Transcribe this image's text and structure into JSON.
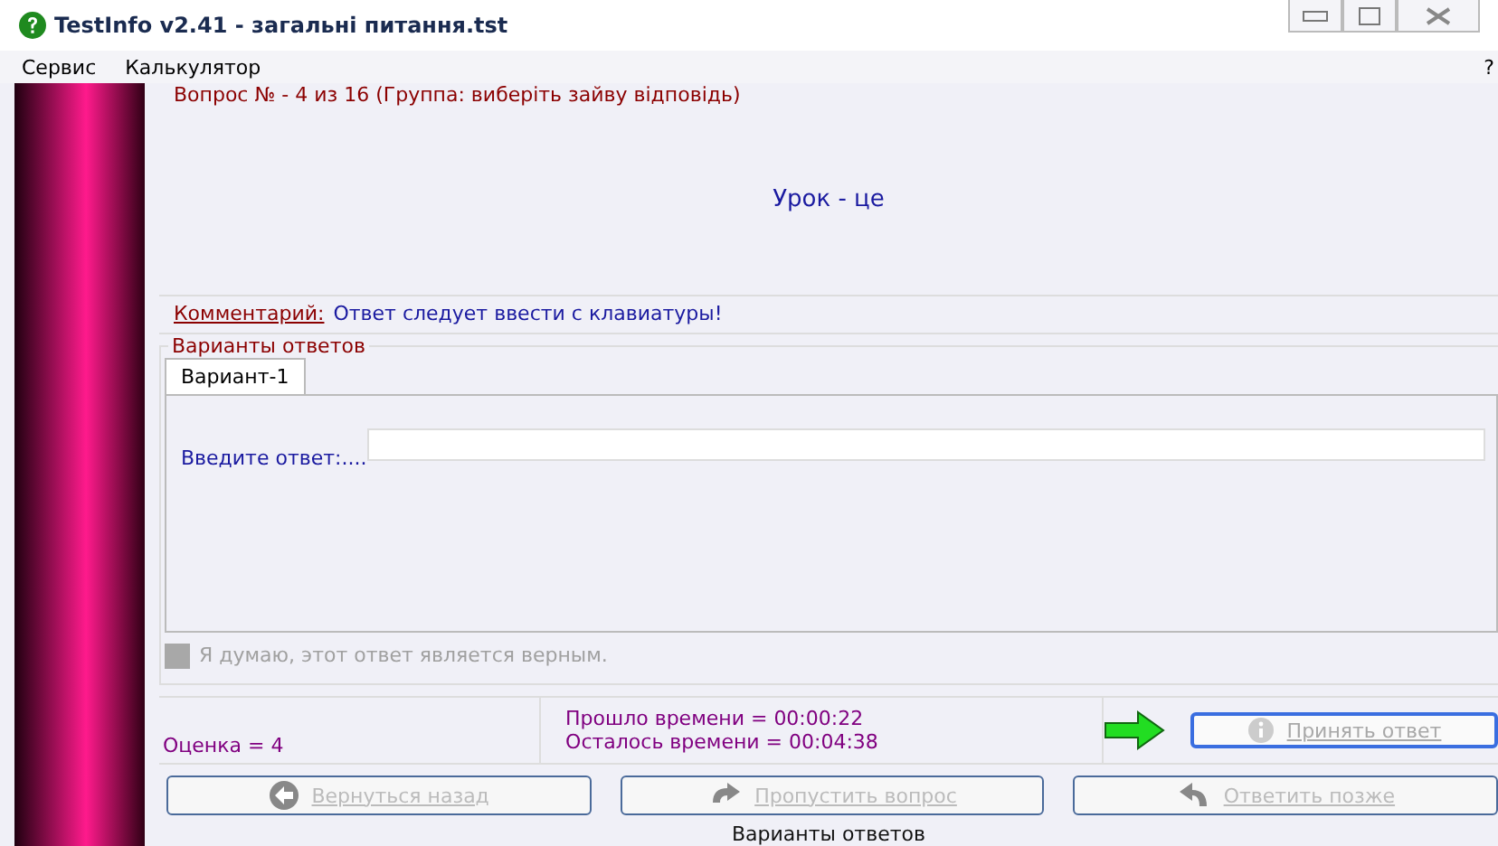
{
  "window": {
    "title": "TestInfo v2.41 - загальні питання.tst"
  },
  "menu": [
    {
      "label": "Сервис"
    },
    {
      "label": "Калькулятор"
    }
  ],
  "menu_help": "?",
  "question": {
    "header": "Вопрос № - 4 из 16  (Группа: виберіть зайву відповідь)",
    "text": "Урок - це"
  },
  "comment": {
    "label": "Комментарий:",
    "text": "Ответ следует ввести с клавиатуры!"
  },
  "answers": {
    "title": "Варианты ответов",
    "tabs": [
      {
        "label": "Вариант-1",
        "selected": true
      }
    ],
    "prompt": "Введите ответ:...."
  },
  "confidence": {
    "label": "Я думаю, этот ответ является верным.",
    "checked": false,
    "disabled": true
  },
  "score": "Оценка = 4",
  "elapsed": "Прошло времени = 00:00:22",
  "remaining": "Осталось времени = 00:04:38",
  "accept": {
    "label": "Принять ответ",
    "disabled": true
  },
  "buttons": [
    {
      "kind": "back",
      "label": "Вернуться назад",
      "disabled": true
    },
    {
      "kind": "skip",
      "label": "Пропустить вопрос",
      "disabled": true
    },
    {
      "kind": "later",
      "label": "Ответить позже",
      "disabled": true
    }
  ],
  "status_bar": "Варианты ответов"
}
